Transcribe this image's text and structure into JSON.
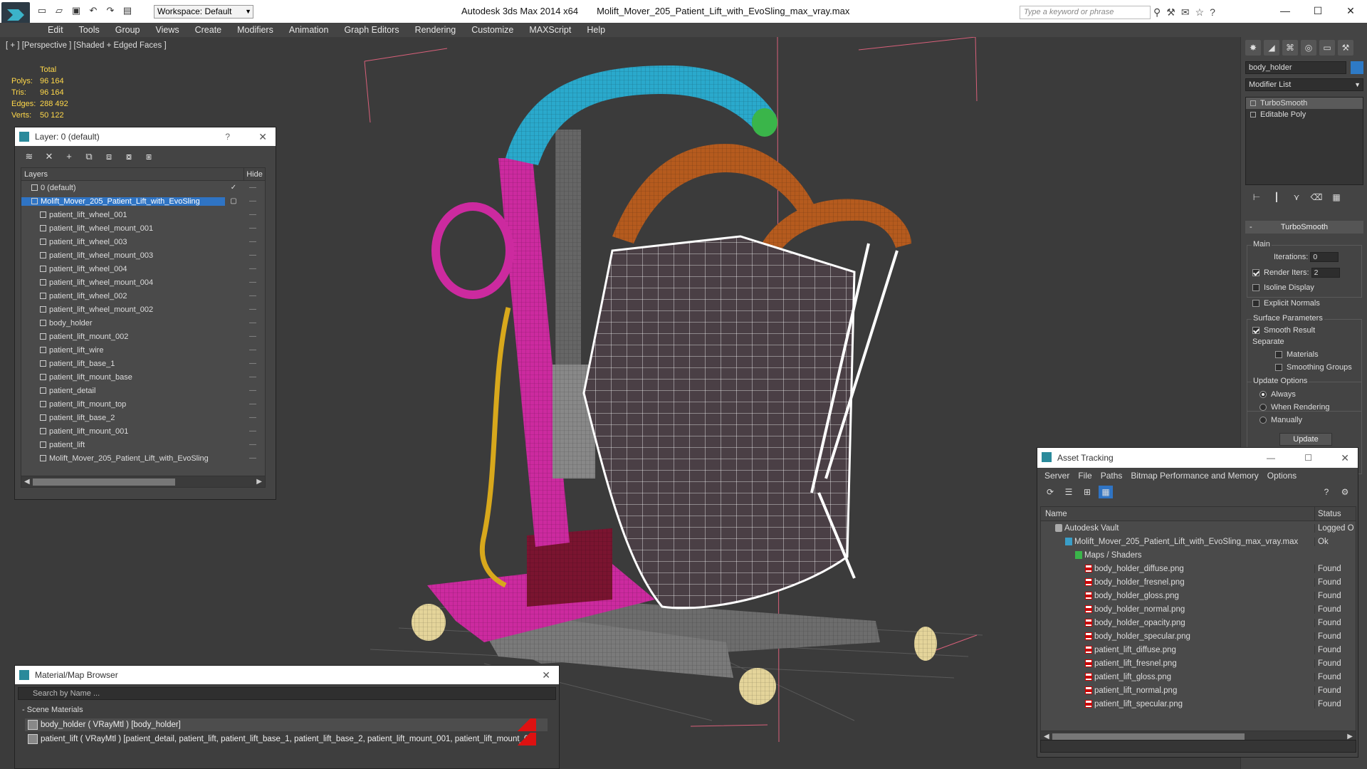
{
  "app": {
    "title": "Autodesk 3ds Max  2014 x64",
    "filename": "Molift_Mover_205_Patient_Lift_with_EvoSling_max_vray.max",
    "workspace": "Workspace: Default",
    "search_placeholder": "Type a keyword or phrase"
  },
  "menu": [
    "Edit",
    "Tools",
    "Group",
    "Views",
    "Create",
    "Modifiers",
    "Animation",
    "Graph Editors",
    "Rendering",
    "Customize",
    "MAXScript",
    "Help"
  ],
  "viewport": {
    "label": "[ + ] [Perspective ] [Shaded + Edged Faces ]",
    "stats": {
      "header": "Total",
      "rows": [
        {
          "k": "Polys:",
          "v": "96 164"
        },
        {
          "k": "Tris:",
          "v": "96 164"
        },
        {
          "k": "Edges:",
          "v": "288 492"
        },
        {
          "k": "Verts:",
          "v": "50 122"
        }
      ]
    }
  },
  "layer_dialog": {
    "title": "Layer: 0 (default)",
    "help": "?",
    "col_layers": "Layers",
    "col_hide": "Hide",
    "rows": [
      {
        "name": "0 (default)",
        "flag": "✓"
      },
      {
        "name": "Molift_Mover_205_Patient_Lift_with_EvoSling",
        "flag": "▢"
      },
      {
        "name": "patient_lift_wheel_001",
        "flag": ""
      },
      {
        "name": "patient_lift_wheel_mount_001",
        "flag": ""
      },
      {
        "name": "patient_lift_wheel_003",
        "flag": ""
      },
      {
        "name": "patient_lift_wheel_mount_003",
        "flag": ""
      },
      {
        "name": "patient_lift_wheel_004",
        "flag": ""
      },
      {
        "name": "patient_lift_wheel_mount_004",
        "flag": ""
      },
      {
        "name": "patient_lift_wheel_002",
        "flag": ""
      },
      {
        "name": "patient_lift_wheel_mount_002",
        "flag": ""
      },
      {
        "name": "body_holder",
        "flag": ""
      },
      {
        "name": "patient_lift_mount_002",
        "flag": ""
      },
      {
        "name": "patient_lift_wire",
        "flag": ""
      },
      {
        "name": "patient_lift_base_1",
        "flag": ""
      },
      {
        "name": "patient_lift_mount_base",
        "flag": ""
      },
      {
        "name": "patient_detail",
        "flag": ""
      },
      {
        "name": "patient_lift_mount_top",
        "flag": ""
      },
      {
        "name": "patient_lift_base_2",
        "flag": ""
      },
      {
        "name": "patient_lift_mount_001",
        "flag": ""
      },
      {
        "name": "patient_lift",
        "flag": ""
      },
      {
        "name": "Molift_Mover_205_Patient_Lift_with_EvoSling",
        "flag": ""
      }
    ]
  },
  "command_panel": {
    "object_name": "body_holder",
    "object_color": "#2e7ac6",
    "modifier_list": "Modifier List",
    "stack": [
      "TurboSmooth",
      "Editable Poly"
    ],
    "rollout": "TurboSmooth",
    "main_label": "Main",
    "iterations_label": "Iterations:",
    "iterations_value": "0",
    "render_iters_label": "Render Iters:",
    "render_iters_value": "2",
    "isoline": "Isoline Display",
    "explicit_normals": "Explicit Normals",
    "surface_params": "Surface Parameters",
    "smooth_result": "Smooth Result",
    "separate": "Separate",
    "materials": "Materials",
    "smoothing_groups": "Smoothing Groups",
    "update_options": "Update Options",
    "always": "Always",
    "when_rendering": "When Rendering",
    "manually": "Manually",
    "update_btn": "Update"
  },
  "material_browser": {
    "title": "Material/Map Browser",
    "search_placeholder": "Search by Name ...",
    "section": "Scene Materials",
    "rows": [
      "body_holder ( VRayMtl ) [body_holder]",
      "patient_lift ( VRayMtl ) [patient_detail, patient_lift, patient_lift_base_1, patient_lift_base_2, patient_lift_mount_001, patient_lift_mount_0..."
    ]
  },
  "asset_tracking": {
    "title": "Asset Tracking",
    "menu": [
      "Server",
      "File",
      "Paths",
      "Bitmap Performance and Memory",
      "Options"
    ],
    "col_name": "Name",
    "col_status": "Status",
    "rows": [
      {
        "name": "Autodesk Vault",
        "status": "Logged O",
        "indent": 1,
        "icon": "vault"
      },
      {
        "name": "Molift_Mover_205_Patient_Lift_with_EvoSling_max_vray.max",
        "status": "Ok",
        "indent": 2,
        "icon": "max"
      },
      {
        "name": "Maps / Shaders",
        "status": "",
        "indent": 3,
        "icon": "map"
      },
      {
        "name": "body_holder_diffuse.png",
        "status": "Found",
        "indent": 4,
        "icon": "png"
      },
      {
        "name": "body_holder_fresnel.png",
        "status": "Found",
        "indent": 4,
        "icon": "png"
      },
      {
        "name": "body_holder_gloss.png",
        "status": "Found",
        "indent": 4,
        "icon": "png"
      },
      {
        "name": "body_holder_normal.png",
        "status": "Found",
        "indent": 4,
        "icon": "png"
      },
      {
        "name": "body_holder_opacity.png",
        "status": "Found",
        "indent": 4,
        "icon": "png"
      },
      {
        "name": "body_holder_specular.png",
        "status": "Found",
        "indent": 4,
        "icon": "png"
      },
      {
        "name": "patient_lift_diffuse.png",
        "status": "Found",
        "indent": 4,
        "icon": "png"
      },
      {
        "name": "patient_lift_fresnel.png",
        "status": "Found",
        "indent": 4,
        "icon": "png"
      },
      {
        "name": "patient_lift_gloss.png",
        "status": "Found",
        "indent": 4,
        "icon": "png"
      },
      {
        "name": "patient_lift_normal.png",
        "status": "Found",
        "indent": 4,
        "icon": "png"
      },
      {
        "name": "patient_lift_specular.png",
        "status": "Found",
        "indent": 4,
        "icon": "png"
      }
    ]
  }
}
